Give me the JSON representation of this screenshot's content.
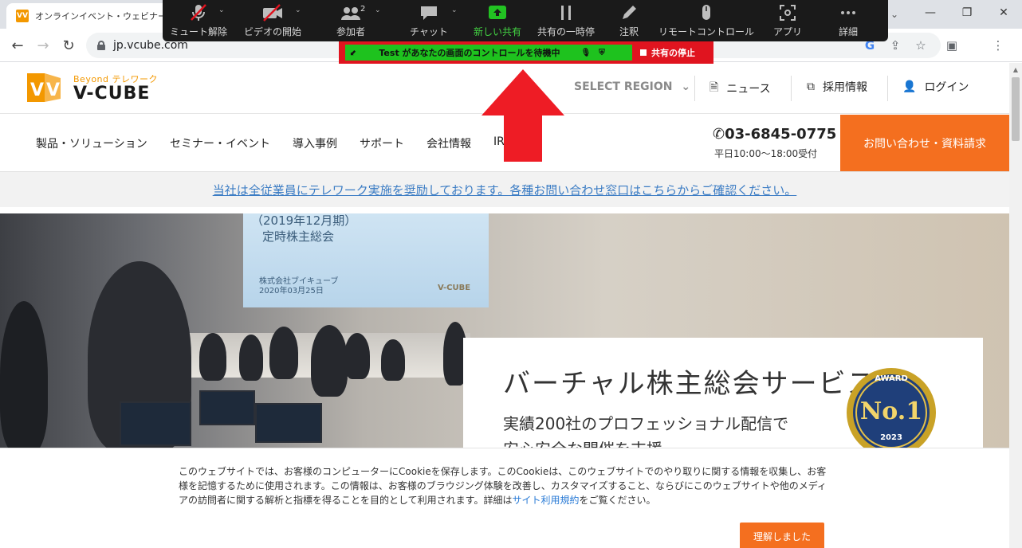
{
  "browser": {
    "tab_title": "オンラインイベント・ウェビナー・Web会議",
    "favicon_text": "VV",
    "url": "jp.vcube.com"
  },
  "zoom": {
    "toolbar": [
      {
        "label": "ミュート解除",
        "icon": "mic-off-icon"
      },
      {
        "label": "ビデオの開始",
        "icon": "video-off-icon"
      },
      {
        "label": "参加者",
        "icon": "participants-icon",
        "count": "2"
      },
      {
        "label": "チャット",
        "icon": "chat-icon"
      },
      {
        "label": "新しい共有",
        "icon": "share-icon"
      },
      {
        "label": "共有の一時停",
        "icon": "pause-icon"
      },
      {
        "label": "注釈",
        "icon": "pencil-icon"
      },
      {
        "label": "リモートコントロール",
        "icon": "mouse-icon"
      },
      {
        "label": "アプリ",
        "icon": "apps-icon"
      },
      {
        "label": "詳細",
        "icon": "more-icon"
      }
    ],
    "share_status": "Test があなたの画面のコントロールを待機中",
    "stop_share": "共有の停止",
    "accent_green": "#1ec21e",
    "accent_red": "#e0141f"
  },
  "site": {
    "logo_tagline": "Beyond テレワーク",
    "logo_name": "V-CUBE",
    "region": "SELECT REGION",
    "header_links": [
      "ニュース",
      "採用情報",
      "ログイン"
    ],
    "nav": [
      "製品・ソリューション",
      "セミナー・イベント",
      "導入事例",
      "サポート",
      "会社情報",
      "IR"
    ],
    "phone": "03-6845-0775",
    "hours": "平日10:00〜18:00受付",
    "contact": "お問い合わせ・資料請求",
    "notice": "当社は全従業員にテレワーク実施を奨励しております。各種お問い合わせ窓口はこちらからご確認ください。",
    "hero": {
      "screen_line1": "（2019年12月期）",
      "screen_line2": "定時株主総会",
      "screen_company": "株式会社ブイキューブ",
      "screen_date": "2020年03月25日",
      "screen_logo": "V-CUBE",
      "title": "バーチャル株主総会サービス",
      "sub1": "実績200社のプロフェッショナル配信で",
      "sub2": "安心安全な開催を支援",
      "award_top": "AWARD",
      "award_main": "No.1",
      "award_year": "2023"
    },
    "cookie": {
      "text": "このウェブサイトでは、お客様のコンピューターにCookieを保存します。このCookieは、このウェブサイトでのやり取りに関する情報を収集し、お客様を記憶するために使用されます。この情報は、お客様のブラウジング体験を改善し、カスタマイズすること、ならびにこのウェブサイトや他のメディアの訪問者に関する解析と指標を得ることを目的として利用されます。詳細は",
      "link": "サイト利用規約",
      "suffix": "をご覧ください。",
      "button": "理解しました"
    },
    "brand_orange": "#f46f1f"
  }
}
